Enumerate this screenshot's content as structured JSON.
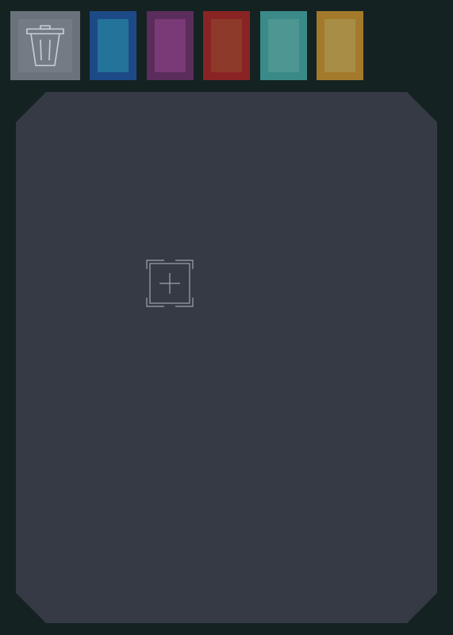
{
  "toolbar": {
    "trash": {
      "icon": "trash-icon",
      "colors": {
        "outer": "#6a737b",
        "inner": "#737c84",
        "stroke": "#c9d0d6"
      }
    },
    "swatches": [
      {
        "name": "blue",
        "outer": "#1d4a86",
        "inner": "#23739a"
      },
      {
        "name": "purple",
        "outer": "#5a2d5c",
        "inner": "#7a3a78"
      },
      {
        "name": "red",
        "outer": "#8a2424",
        "inner": "#8e3a2a"
      },
      {
        "name": "teal",
        "outer": "#3a8a89",
        "inner": "#4d9691"
      },
      {
        "name": "amber",
        "outer": "#a37a2c",
        "inner": "#a78d45"
      }
    ]
  },
  "board": {
    "background": "#363a45",
    "add_target": {
      "icon": "add-plus-icon",
      "stroke": "#9ea4ad"
    }
  },
  "page": {
    "background": "#142222"
  }
}
